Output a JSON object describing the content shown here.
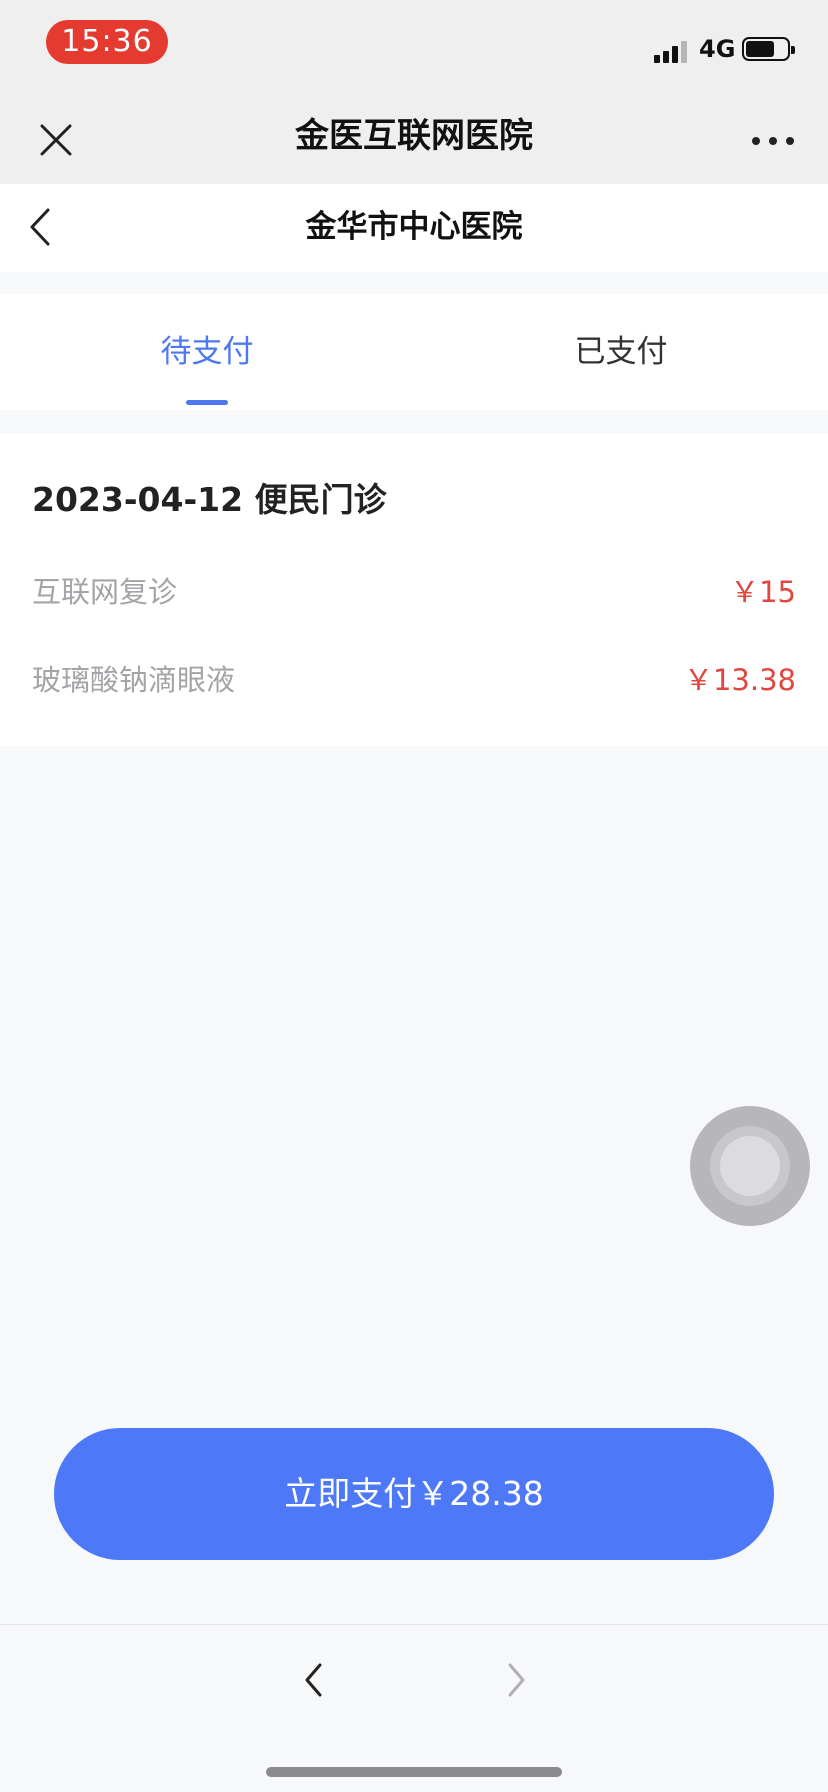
{
  "status_bar": {
    "time": "15:36",
    "network": "4G",
    "battery_level": 0.7,
    "time_pill_color": "#e53a30"
  },
  "app_bar": {
    "title": "金医互联网医院",
    "close_icon": "close-icon",
    "more_icon": "more-horizontal-icon"
  },
  "page_header": {
    "title": "金华市中心医院",
    "back_icon": "chevron-left-icon"
  },
  "tabs": [
    {
      "label": "待支付",
      "active": true
    },
    {
      "label": "已支付",
      "active": false
    }
  ],
  "order": {
    "title": "2023-04-12 便民门诊",
    "items": [
      {
        "name": "互联网复诊",
        "price": "￥15"
      },
      {
        "name": "玻璃酸钠滴眼液",
        "price": "￥13.38"
      }
    ]
  },
  "pay_button": {
    "label": "立即支付￥28.38"
  },
  "colors": {
    "accent": "#4d78f2",
    "price_red": "#e2473f",
    "button_blue": "#4d78f8"
  },
  "browser_nav": {
    "back_icon": "chevron-left-icon",
    "forward_icon": "chevron-right-icon"
  }
}
